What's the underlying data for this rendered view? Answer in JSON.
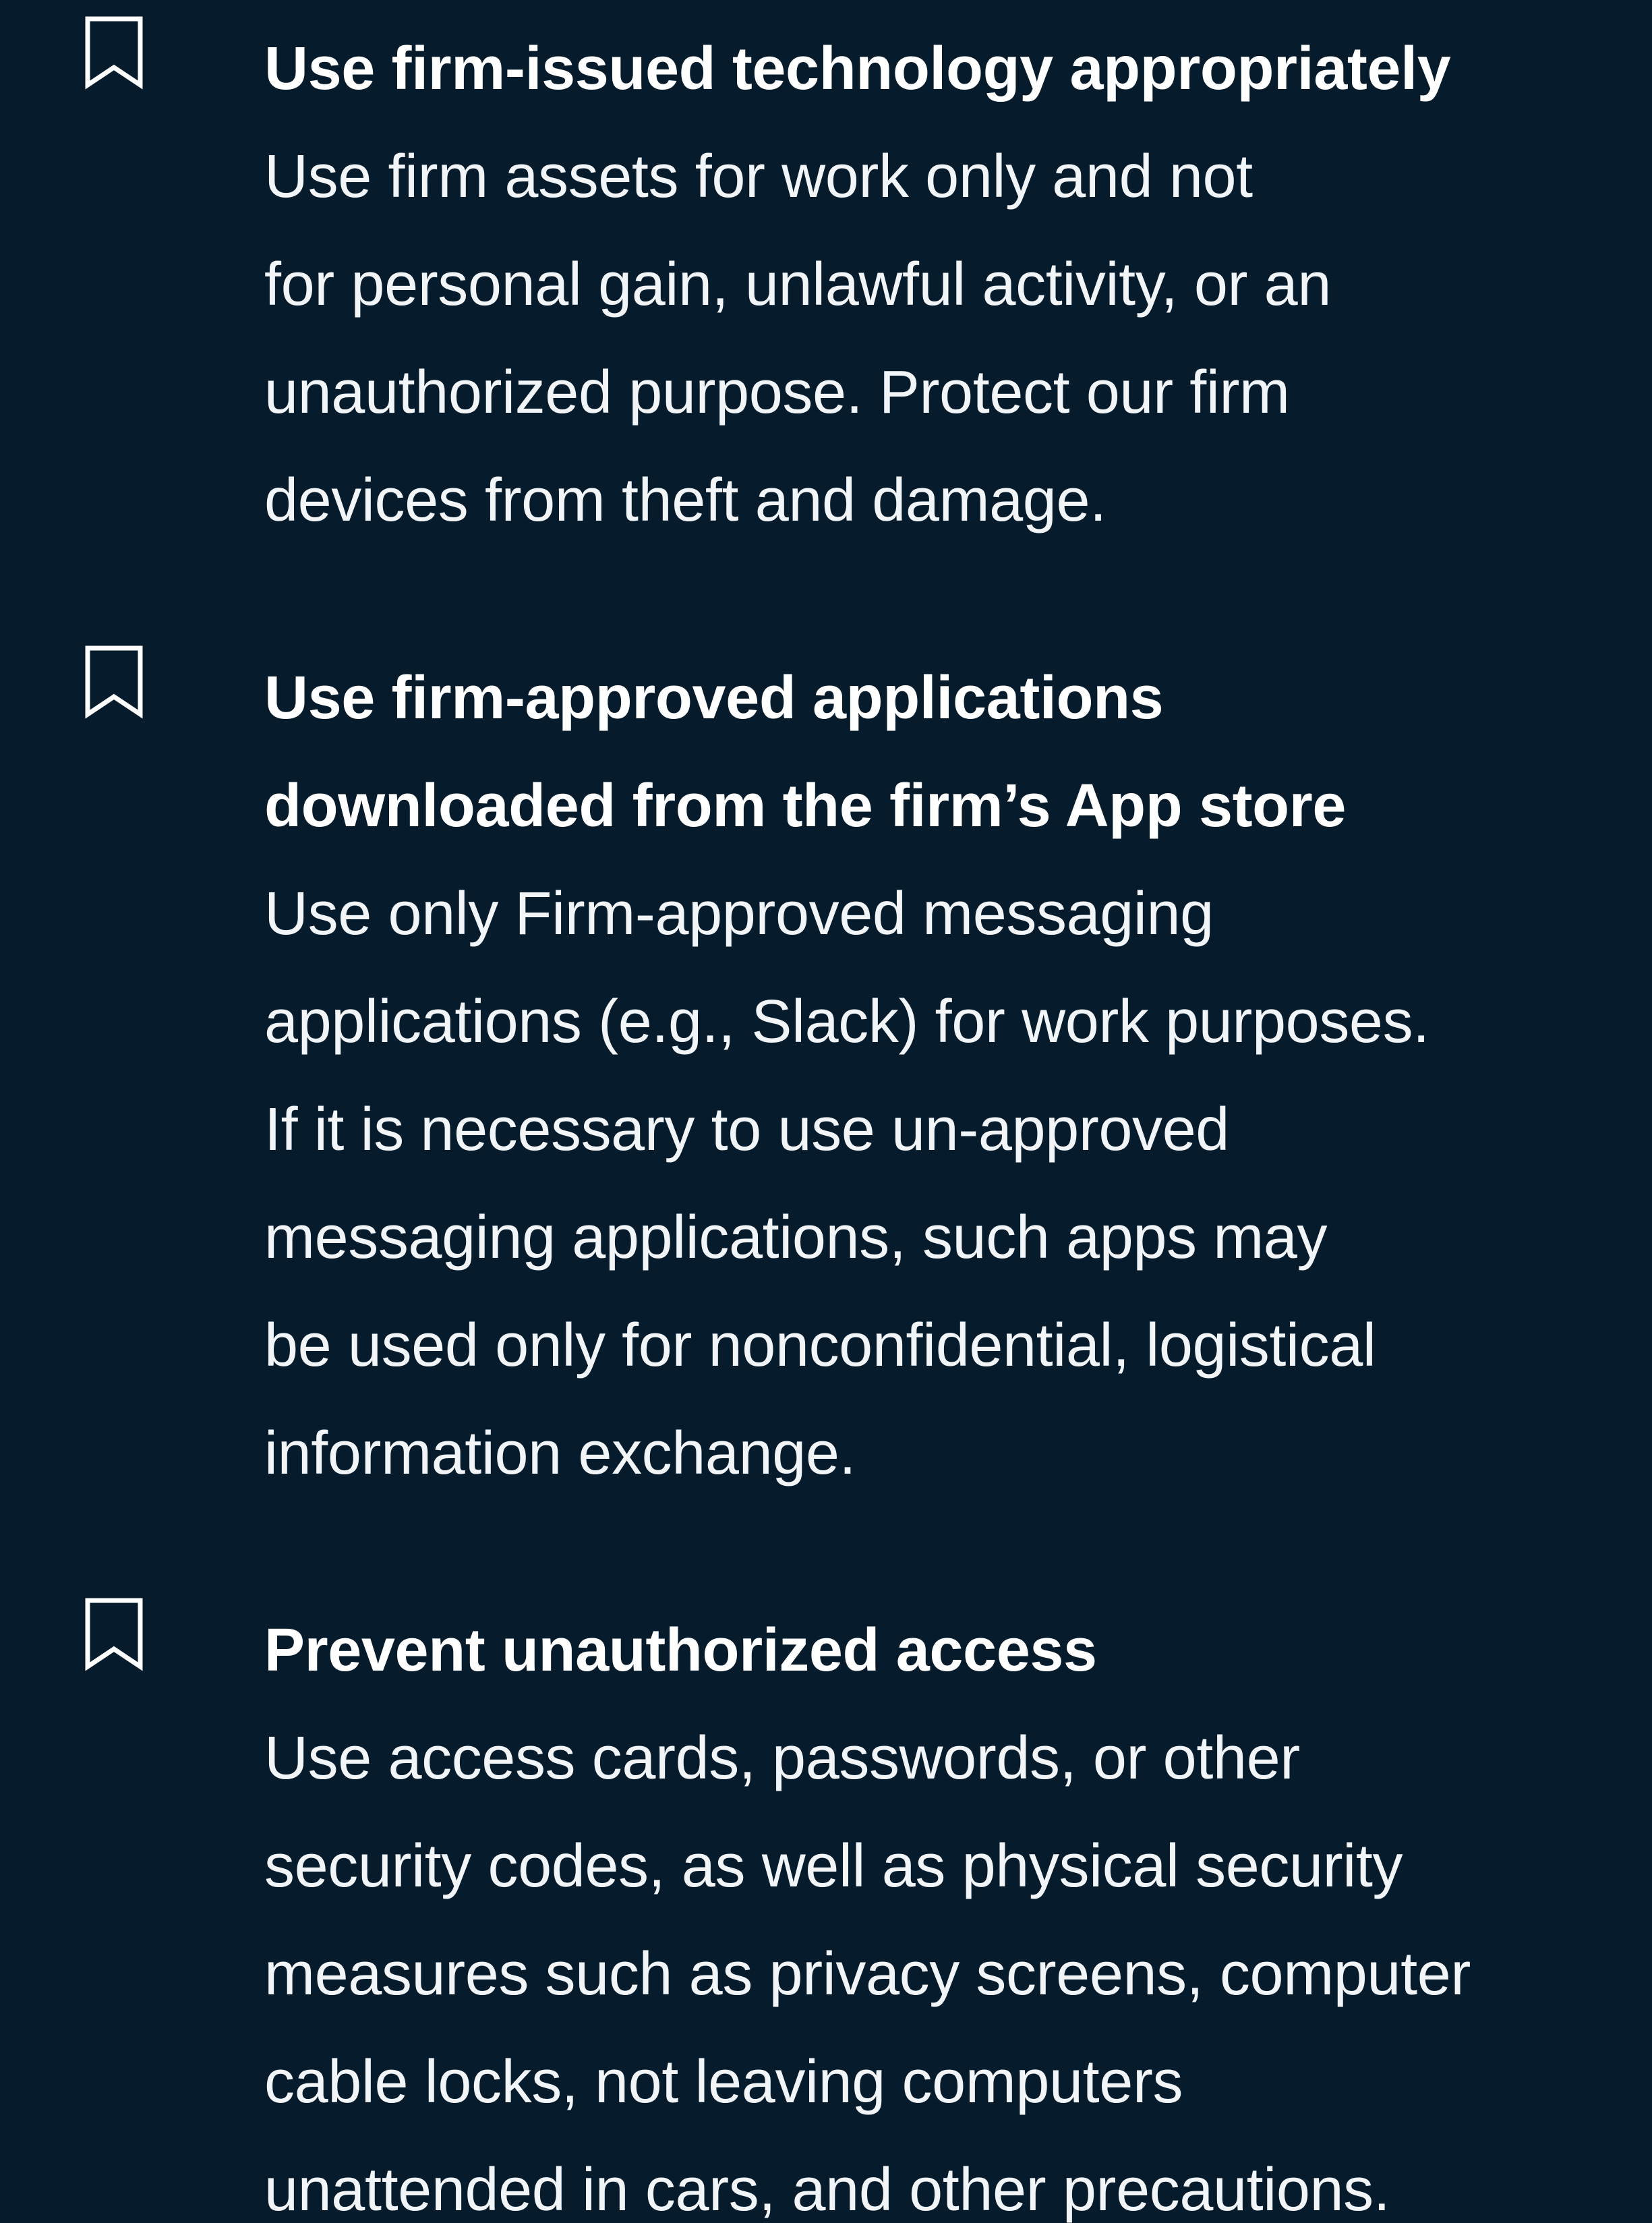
{
  "colors": {
    "background": "#061c2c",
    "text": "#ffffff"
  },
  "items": [
    {
      "icon": "bookmark-icon",
      "heading_lines": [
        "Use firm-issued technology appropriately"
      ],
      "body_lines": [
        "Use firm assets for work only and not",
        "for personal gain, unlawful activity, or an",
        "unauthorized purpose. Protect our firm",
        "devices from theft and damage."
      ]
    },
    {
      "icon": "bookmark-icon",
      "heading_lines": [
        "Use firm-approved applications",
        "downloaded from the firm’s App store"
      ],
      "body_lines": [
        "Use only Firm-approved messaging",
        "applications (e.g., Slack) for work purposes.",
        "If it is necessary to use un-approved",
        "messaging applications, such apps may",
        "be used only for nonconfidential, logistical",
        "information exchange."
      ]
    },
    {
      "icon": "bookmark-icon",
      "heading_lines": [
        "Prevent unauthorized access"
      ],
      "body_lines": [
        "Use access cards, passwords, or other",
        "security codes, as well as physical security",
        "measures such as privacy screens, computer",
        "cable locks, not leaving computers",
        "unattended in cars, and other precautions."
      ]
    }
  ]
}
